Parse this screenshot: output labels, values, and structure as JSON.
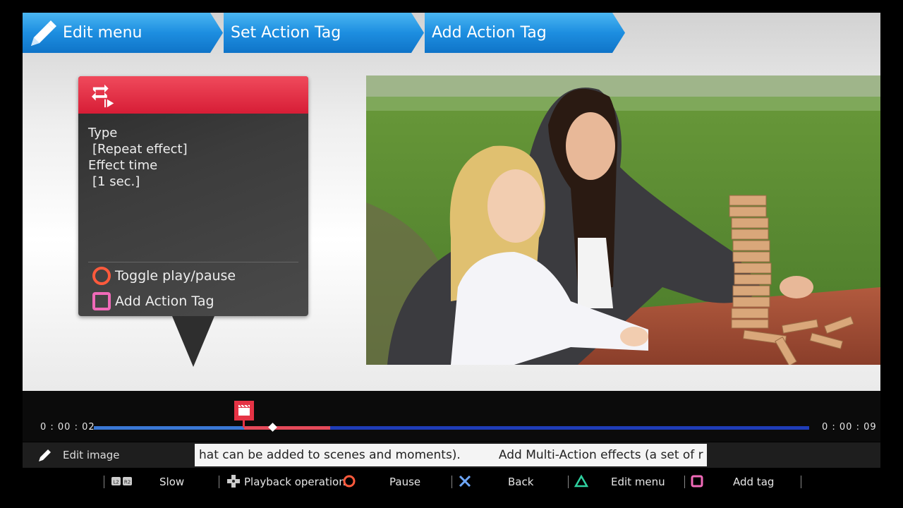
{
  "breadcrumb": [
    "Edit menu",
    "Set Action Tag",
    "Add Action Tag"
  ],
  "info_panel": {
    "type_label": "Type",
    "type_value": "[Repeat effect]",
    "time_label": "Effect time",
    "time_value": "[1 sec.]",
    "actions": [
      {
        "icon": "circle-button-icon",
        "label": "Toggle play/pause"
      },
      {
        "icon": "square-button-icon",
        "label": "Add Action Tag"
      }
    ]
  },
  "timeline": {
    "current_time": "0 : 00 : 02",
    "end_time": "0 : 00 : 09",
    "playhead_fraction": 0.25,
    "tag_start_fraction": 0.21,
    "tag_end_fraction": 0.33
  },
  "edit_bar": {
    "label": "Edit image",
    "ticker_text": "hat can be added to scenes and moments).          Add Multi-Action effects (a set of r"
  },
  "controls": [
    {
      "icon": "l2r2-icon",
      "label": "Slow"
    },
    {
      "icon": "dpad-icon",
      "label": "Playback operation"
    },
    {
      "icon": "circle-button-icon",
      "label": "Pause"
    },
    {
      "icon": "cross-button-icon",
      "label": "Back"
    },
    {
      "icon": "triangle-button-icon",
      "label": "Edit menu"
    },
    {
      "icon": "square-button-icon",
      "label": "Add tag"
    }
  ],
  "colors": {
    "accent_blue": "#1d8ee0",
    "panel_red": "#d71d36",
    "track_blue": "#1f3db8",
    "tag_red": "#e54a5a"
  }
}
